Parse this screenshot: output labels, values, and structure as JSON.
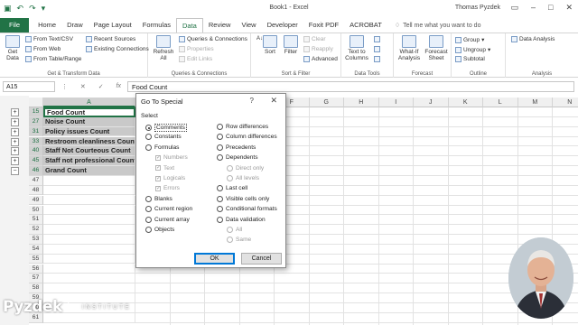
{
  "app": {
    "doc_title": "Book1 - Excel",
    "user_name": "Thomas Pyzdek",
    "accent_color": "#217346"
  },
  "quick_access": {
    "icons": [
      "save-icon",
      "undo-icon",
      "redo-icon",
      "customize-icon"
    ]
  },
  "ribbon_tabs": [
    "File",
    "Home",
    "Draw",
    "Page Layout",
    "Formulas",
    "Data",
    "Review",
    "View",
    "Developer",
    "Foxit PDF",
    "ACROBAT"
  ],
  "active_tab": "Data",
  "tell_me": "Tell me what you want to do",
  "ribbon": {
    "get_transform": {
      "name": "Get & Transform Data",
      "get_data": "Get Data",
      "from_text_csv": "From Text/CSV",
      "from_web": "From Web",
      "from_table_range": "From Table/Range",
      "recent_sources": "Recent Sources",
      "existing_connections": "Existing Connections"
    },
    "queries": {
      "name": "Queries & Connections",
      "refresh_all": "Refresh All",
      "queries_connections": "Queries & Connections",
      "properties": "Properties",
      "edit_links": "Edit Links"
    },
    "sort_filter": {
      "name": "Sort & Filter",
      "sort_az": "A↓Z",
      "sort": "Sort",
      "filter": "Filter",
      "clear": "Clear",
      "reapply": "Reapply",
      "advanced": "Advanced"
    },
    "data_tools": {
      "name": "Data Tools",
      "text_to_columns": "Text to Columns"
    },
    "forecast": {
      "name": "Forecast",
      "what_if": "What-If Analysis",
      "forecast_sheet": "Forecast Sheet"
    },
    "outline": {
      "name": "Outline",
      "group": "Group",
      "ungroup": "Ungroup",
      "subtotal": "Subtotal"
    },
    "analysis": {
      "name": "Analysis",
      "data_analysis": "Data Analysis"
    }
  },
  "formula_bar": {
    "name_box": "A15",
    "cancel": "✕",
    "enter": "✓",
    "fx": "fx",
    "formula": "Food Count"
  },
  "sheet": {
    "columns": [
      "A",
      "B",
      "C",
      "D",
      "E",
      "F",
      "G",
      "H",
      "I",
      "J",
      "K",
      "L",
      "M",
      "N"
    ],
    "rows": [
      {
        "num": "15",
        "text": "Food Count",
        "outline": "+"
      },
      {
        "num": "27",
        "text": "Noise Count",
        "outline": "+"
      },
      {
        "num": "31",
        "text": "Policy issues Count",
        "outline": "+"
      },
      {
        "num": "33",
        "text": "Restroom cleanliness Count",
        "outline": "+"
      },
      {
        "num": "40",
        "text": "Staff Not Courteous Count",
        "outline": "+"
      },
      {
        "num": "45",
        "text": "Staff not professional Count",
        "outline": "+"
      },
      {
        "num": "46",
        "text": "Grand Count",
        "outline": "−"
      },
      {
        "num": "47",
        "text": ""
      },
      {
        "num": "48",
        "text": ""
      },
      {
        "num": "49",
        "text": ""
      },
      {
        "num": "50",
        "text": ""
      },
      {
        "num": "51",
        "text": ""
      },
      {
        "num": "52",
        "text": ""
      },
      {
        "num": "53",
        "text": ""
      },
      {
        "num": "54",
        "text": ""
      },
      {
        "num": "55",
        "text": ""
      },
      {
        "num": "56",
        "text": ""
      },
      {
        "num": "57",
        "text": ""
      },
      {
        "num": "58",
        "text": ""
      },
      {
        "num": "59",
        "text": ""
      },
      {
        "num": "60",
        "text": ""
      },
      {
        "num": "61",
        "text": ""
      }
    ]
  },
  "dialog": {
    "title": "Go To Special",
    "help": "?",
    "close": "✕",
    "section": "Select",
    "left_options": [
      {
        "label": "Comments",
        "selected": true
      },
      {
        "label": "Constants"
      },
      {
        "label": "Formulas"
      },
      {
        "label": "Numbers",
        "sub": true
      },
      {
        "label": "Text",
        "sub": true
      },
      {
        "label": "Logicals",
        "sub": true
      },
      {
        "label": "Errors",
        "sub": true
      },
      {
        "label": "Blanks"
      },
      {
        "label": "Current region"
      },
      {
        "label": "Current array"
      },
      {
        "label": "Objects"
      }
    ],
    "right_options": [
      {
        "label": "Row differences"
      },
      {
        "label": "Column differences"
      },
      {
        "label": "Precedents"
      },
      {
        "label": "Dependents"
      },
      {
        "label": "Direct only",
        "sub": true
      },
      {
        "label": "All levels",
        "sub": true
      },
      {
        "label": "Last cell"
      },
      {
        "label": "Visible cells only"
      },
      {
        "label": "Conditional formats"
      },
      {
        "label": "Data validation"
      },
      {
        "label": "All",
        "sub": true
      },
      {
        "label": "Same",
        "sub": true
      }
    ],
    "ok": "OK",
    "cancel": "Cancel"
  },
  "watermark": {
    "brand": "Pyzdek",
    "suffix": "INSTITUTE"
  }
}
